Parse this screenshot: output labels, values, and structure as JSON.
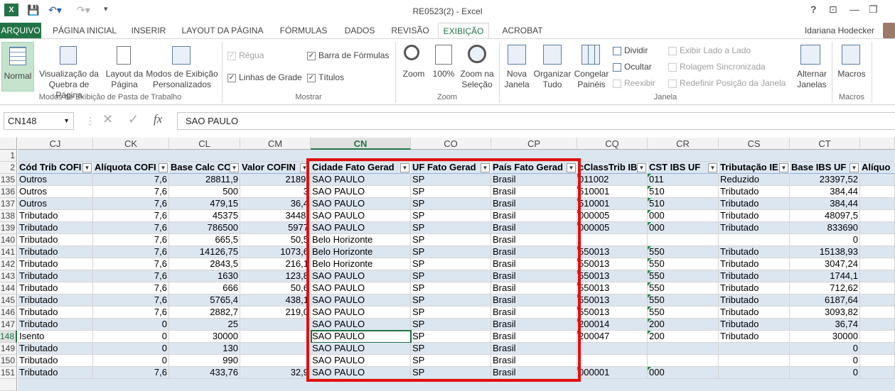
{
  "window": {
    "title": "RE0523(2) - Excel"
  },
  "tabs": [
    "ARQUIVO",
    "PÁGINA INICIAL",
    "INSERIR",
    "LAYOUT DA PÁGINA",
    "FÓRMULAS",
    "DADOS",
    "REVISÃO",
    "EXIBIÇÃO",
    "ACROBAT"
  ],
  "user": "Idariana Hodecker",
  "ribbon": {
    "workbook_views": {
      "normal": "Normal",
      "page_break": "Visualização da Quebra de Página",
      "page_layout": "Layout da Página",
      "custom": "Modos de Exibição Personalizados",
      "group": "Modos de Exibição de Pasta de Trabalho"
    },
    "show": {
      "ruler": "Régua",
      "formula_bar": "Barra de Fórmulas",
      "gridlines": "Linhas de Grade",
      "headings": "Títulos",
      "group": "Mostrar"
    },
    "zoom": {
      "zoom": "Zoom",
      "zoom100": "100%",
      "zoom_sel": "Zoom na Seleção",
      "group": "Zoom"
    },
    "window": {
      "new": "Nova Janela",
      "arrange": "Organizar Tudo",
      "freeze": "Congelar Painéis",
      "split": "Dividir",
      "hide": "Ocultar",
      "unhide": "Reexibir",
      "side": "Exibir Lado a Lado",
      "sync": "Rolagem Sincronizada",
      "reset": "Redefinir Posição da Janela",
      "switch": "Alternar Janelas",
      "group": "Janela"
    },
    "macros": {
      "macros": "Macros",
      "group": "Macros"
    }
  },
  "formula_bar": {
    "name_box": "CN148",
    "fx": "fx",
    "value": "SAO PAULO"
  },
  "columns": [
    "CJ",
    "CK",
    "CL",
    "CM",
    "CN",
    "CO",
    "CP",
    "CQ",
    "CR",
    "CS",
    "CT"
  ],
  "headers": [
    "Cód Trib COFI",
    "Alíquota COFI",
    "Base Calc CO",
    "Valor COFIN",
    "Cidade Fato Gerad",
    "UF Fato Gerad",
    "País Fato Gerad",
    "cClassTrib IB",
    "CST IBS UF",
    "Tributação IE",
    "Base IBS UF",
    "Alíquo"
  ],
  "rows": [
    {
      "n": "135",
      "c": [
        "Outros",
        "7,6",
        "28811,9",
        "2189,",
        "SAO PAULO",
        "SP",
        "Brasil",
        "011002",
        "011",
        "Reduzido",
        "23397,52"
      ]
    },
    {
      "n": "136",
      "c": [
        "Outros",
        "7,6",
        "500",
        "3",
        "SAO PAULO",
        "SP",
        "Brasil",
        "510001",
        "510",
        "Tributado",
        "384,44"
      ]
    },
    {
      "n": "137",
      "c": [
        "Outros",
        "7,6",
        "479,15",
        "36,4",
        "SAO PAULO",
        "SP",
        "Brasil",
        "510001",
        "510",
        "Tributado",
        "384,44"
      ]
    },
    {
      "n": "138",
      "c": [
        "Tributado",
        "7,6",
        "45375",
        "3448,",
        "SAO PAULO",
        "SP",
        "Brasil",
        "000005",
        "000",
        "Tributado",
        "48097,5"
      ]
    },
    {
      "n": "139",
      "c": [
        "Tributado",
        "7,6",
        "786500",
        "5977",
        "SAO PAULO",
        "SP",
        "Brasil",
        "000005",
        "000",
        "Tributado",
        "833690"
      ]
    },
    {
      "n": "140",
      "c": [
        "Tributado",
        "7,6",
        "665,5",
        "50,5",
        "Belo Horizonte",
        "SP",
        "Brasil",
        "",
        "",
        "",
        "0"
      ]
    },
    {
      "n": "141",
      "c": [
        "Tributado",
        "7,6",
        "14126,75",
        "1073,6",
        "Belo Horizonte",
        "SP",
        "Brasil",
        "550013",
        "550",
        "Tributado",
        "15138,93"
      ]
    },
    {
      "n": "142",
      "c": [
        "Tributado",
        "7,6",
        "2843,5",
        "216,1",
        "Belo Horizonte",
        "SP",
        "Brasil",
        "550013",
        "550",
        "Tributado",
        "3047,24"
      ]
    },
    {
      "n": "143",
      "c": [
        "Tributado",
        "7,6",
        "1630",
        "123,8",
        "SAO PAULO",
        "SP",
        "Brasil",
        "550013",
        "550",
        "Tributado",
        "1744,1"
      ]
    },
    {
      "n": "144",
      "c": [
        "Tributado",
        "7,6",
        "666",
        "50,6",
        "SAO PAULO",
        "SP",
        "Brasil",
        "550013",
        "550",
        "Tributado",
        "712,62"
      ]
    },
    {
      "n": "145",
      "c": [
        "Tributado",
        "7,6",
        "5765,4",
        "438,1",
        "SAO PAULO",
        "SP",
        "Brasil",
        "550013",
        "550",
        "Tributado",
        "6187,64"
      ]
    },
    {
      "n": "146",
      "c": [
        "Tributado",
        "7,6",
        "2882,7",
        "219,0",
        "SAO PAULO",
        "SP",
        "Brasil",
        "550013",
        "550",
        "Tributado",
        "3093,82"
      ]
    },
    {
      "n": "147",
      "c": [
        "Tributado",
        "0",
        "25",
        "",
        "SAO PAULO",
        "SP",
        "Brasil",
        "200014",
        "200",
        "Tributado",
        "36,74"
      ]
    },
    {
      "n": "148",
      "c": [
        "Isento",
        "0",
        "30000",
        "",
        "SAO PAULO",
        "SP",
        "Brasil",
        "200047",
        "200",
        "Tributado",
        "30000"
      ]
    },
    {
      "n": "149",
      "c": [
        "Tributado",
        "0",
        "130",
        "",
        "SAO PAULO",
        "SP",
        "Brasil",
        "",
        "",
        "",
        "0"
      ]
    },
    {
      "n": "150",
      "c": [
        "Tributado",
        "0",
        "990",
        "",
        "SAO PAULO",
        "SP",
        "Brasil",
        "",
        "",
        "",
        "0"
      ]
    },
    {
      "n": "151",
      "c": [
        "Tributado",
        "7,6",
        "433,76",
        "32,9",
        "SAO PAULO",
        "SP",
        "Brasil",
        "000001",
        "000",
        "",
        "0"
      ]
    }
  ]
}
